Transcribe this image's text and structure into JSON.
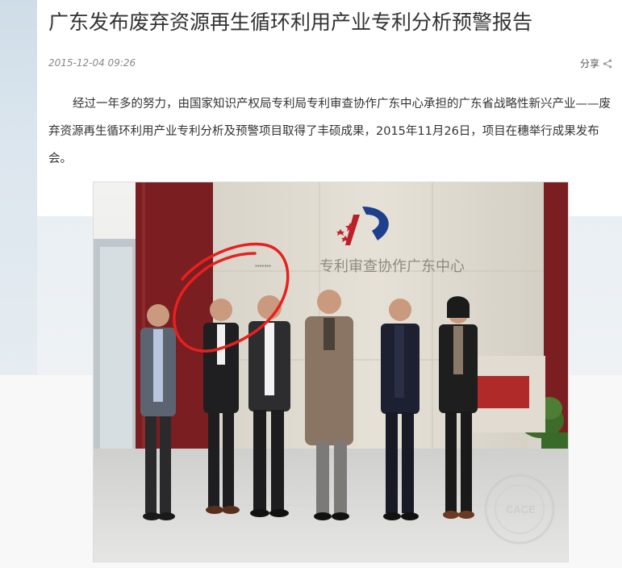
{
  "article": {
    "title": "广东发布废弃资源再生循环利用产业专利分析预警报告",
    "datetime": "2015-12-04 09:26",
    "share_label": "分享",
    "paragraph": "经过一年多的努力，由国家知识产权局专利局专利审查协作广东中心承担的广东省战略性新兴产业——废弃资源再生循环利用产业专利分析及预警项目取得了丰硕成果，2015年11月26日，项目在穗举行成果发布会。"
  },
  "photo": {
    "wall_sign": "专利审查协作广东中心",
    "watermark_text": "CACE"
  },
  "colors": {
    "title_text": "#333333",
    "meta_text": "#888888",
    "circle_annotation": "#e8201e",
    "wall_red": "#7a1e22"
  }
}
